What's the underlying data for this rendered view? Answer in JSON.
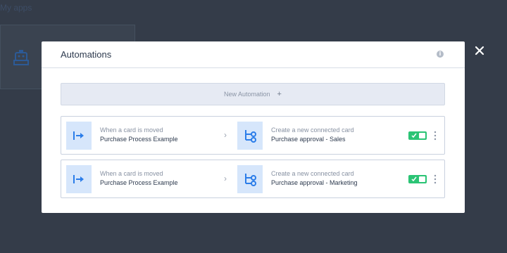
{
  "background": {
    "title": "My apps"
  },
  "modal": {
    "title": "Automations",
    "info_icon": "info-icon",
    "new_automation_label": "New Automation",
    "plus": "+"
  },
  "automations": [
    {
      "trigger_label": "When a card is moved",
      "trigger_pipe": "Purchase Process Example",
      "action_label": "Create a new connected card",
      "action_target": "Purchase approval - Sales",
      "enabled": true
    },
    {
      "trigger_label": "When a card is moved",
      "trigger_pipe": "Purchase Process Example",
      "action_label": "Create a new connected card",
      "action_target": "Purchase approval - Marketing",
      "enabled": true
    }
  ],
  "colors": {
    "backdrop": "#343c49",
    "accent_blue": "#2b7de9",
    "icon_bg": "#d6e6fb",
    "toggle_on": "#2bc475"
  },
  "icons": {
    "close": "close-icon",
    "trigger": "move-arrow-icon",
    "action": "connection-icon",
    "menu": "kebab-menu-icon",
    "chevron": "chevron-right-icon"
  }
}
